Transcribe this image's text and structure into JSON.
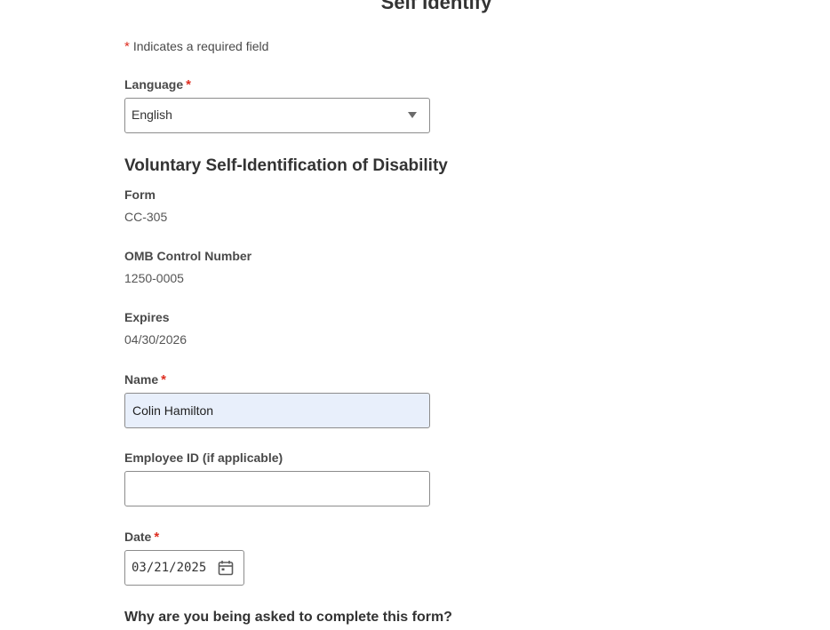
{
  "page": {
    "title": "Self Identify",
    "required_note": "Indicates a required field",
    "required_marker": "*"
  },
  "language": {
    "label": "Language",
    "selected": "English"
  },
  "section": {
    "heading": "Voluntary Self-Identification of Disability"
  },
  "form_info": {
    "form_label": "Form",
    "form_value": "CC-305",
    "omb_label": "OMB Control Number",
    "omb_value": "1250-0005",
    "expires_label": "Expires",
    "expires_value": "04/30/2026"
  },
  "fields": {
    "name_label": "Name",
    "name_value": "Colin Hamilton",
    "employee_id_label": "Employee ID (if applicable)",
    "employee_id_value": "",
    "date_label": "Date",
    "date_value": "03/21/2025"
  },
  "question": {
    "text": "Why are you being asked to complete this form?"
  },
  "icons": {
    "dropdown": "chevron-down-icon",
    "calendar": "calendar-icon"
  },
  "colors": {
    "required": "#de2e21",
    "autofill_bg": "#e8effb",
    "border": "#8c8c8c"
  }
}
